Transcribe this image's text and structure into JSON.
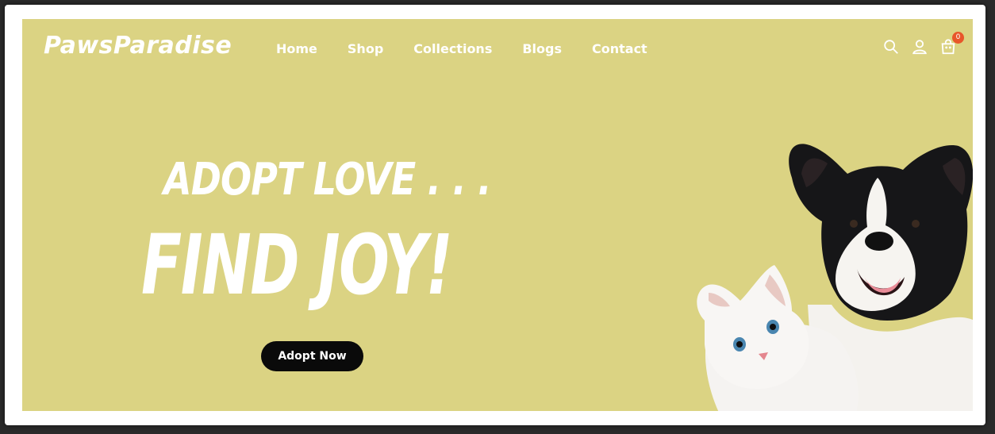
{
  "header": {
    "logo": "PawsParadise",
    "nav": [
      {
        "label": "Home"
      },
      {
        "label": "Shop"
      },
      {
        "label": "Collections"
      },
      {
        "label": "Blogs"
      },
      {
        "label": "Contact"
      }
    ],
    "icons": [
      "search-icon",
      "user-icon",
      "cart-icon"
    ],
    "cart_count": "0"
  },
  "hero": {
    "line1": "ADOPT LOVE . . .",
    "line2": "FIND JOY!",
    "cta_label": "Adopt Now",
    "illustration": "dog-and-cat-image"
  },
  "colors": {
    "hero_bg": "#dbd383",
    "text": "#ffffff",
    "cta_bg": "#0a0a0a",
    "badge": "#e8562a"
  }
}
